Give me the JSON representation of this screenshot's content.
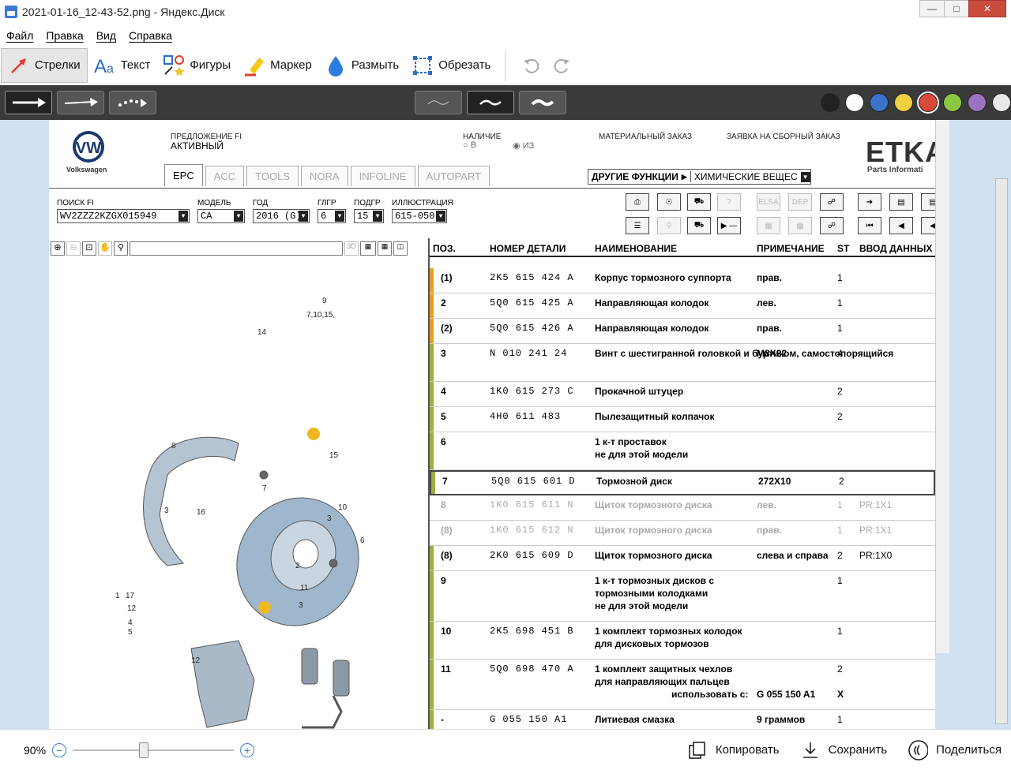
{
  "window": {
    "title": "2021-01-16_12-43-52.png - Яндекс.Диск"
  },
  "menu": [
    "Файл",
    "Правка",
    "Вид",
    "Справка"
  ],
  "toolbar": {
    "tools": [
      {
        "label": "Стрелки",
        "icon": "arrow-icon",
        "active": true
      },
      {
        "label": "Текст",
        "icon": "text-icon"
      },
      {
        "label": "Фигуры",
        "icon": "shapes-icon"
      },
      {
        "label": "Маркер",
        "icon": "marker-icon"
      },
      {
        "label": "Размыть",
        "icon": "blur-icon"
      },
      {
        "label": "Обрезать",
        "icon": "crop-icon"
      }
    ]
  },
  "colors": [
    "#222222",
    "#ffffff",
    "#3a73c9",
    "#f0d040",
    "#d94a3a",
    "#8cc63f",
    "#9b72c4",
    "#e8e8e8"
  ],
  "etka": {
    "offer_label": "ПРЕДЛОЖЕНИЕ FI",
    "offer_value": "АКТИВНЫЙ",
    "availability_label": "НАЛИЧИЕ",
    "avail_in": "В",
    "avail_out": "ИЗ",
    "material_order": "МАТЕРИАЛЬНЫЙ ЗАКАЗ",
    "assembly_order": "ЗАЯВКА НА СБОРНЫЙ ЗАКАЗ",
    "brand": "Volkswagen",
    "logo_text": "ETKA",
    "logo_sub": "Parts Informati",
    "tabs": [
      "EPC",
      "ACC",
      "TOOLS",
      "NORA",
      "INFOLINE",
      "AUTOPART"
    ],
    "other_functions": "ДРУГИЕ ФУНКЦИИ",
    "chemicals": "ХИМИЧЕСКИЕ ВЕЩЕС",
    "fields": {
      "search_label": "ПОИСК FI",
      "search_value": "WV2ZZZ2KZGX015949",
      "model_label": "МОДЕЛЬ",
      "model_value": "CA",
      "year_label": "ГОД",
      "year_value": "2016 (G)",
      "mg_label": "ГЛГР",
      "mg_value": "6",
      "sg_label": "ПОДГР",
      "sg_value": "15",
      "ill_label": "ИЛЛЮСТРАЦИЯ",
      "ill_value": "615-050"
    },
    "columns": [
      "ПОЗ.",
      "НОМЕР ДЕТАЛИ",
      "НАИМЕНОВАНИЕ",
      "ПРИМЕЧАНИЕ",
      "ST",
      "ВВОД ДАННЫХ"
    ],
    "rows": [
      {
        "pos": "(1)",
        "num": "2K5  615  424  A",
        "name": "Корпус тормозного суппорта",
        "note": "прав.",
        "st": "1",
        "data": "",
        "bar": "#e8a020"
      },
      {
        "pos": "2",
        "num": "5Q0  615  425  A",
        "name": "Направляющая колодок",
        "note": "лев.",
        "st": "1",
        "data": "",
        "bar": "#e8a020"
      },
      {
        "pos": "(2)",
        "num": "5Q0  615  426  A",
        "name": "Направляющая колодок",
        "note": "прав.",
        "st": "1",
        "data": "",
        "bar": "#e8a020"
      },
      {
        "pos": "3",
        "num": "N    010  241  24",
        "name": "Винт с шестигранной головкой и буртиком, самостопорящийся",
        "note": "M8X22",
        "st": "4",
        "data": "",
        "bar": "#9bb040"
      },
      {
        "pos": "4",
        "num": "1K0  615  273  C",
        "name": "Прокачной штуцер",
        "note": "",
        "st": "2",
        "data": "",
        "bar": "#9bb040"
      },
      {
        "pos": "5",
        "num": "4H0  611  483",
        "name": "Пылезащитный колпачок",
        "note": "",
        "st": "2",
        "data": "",
        "bar": "#9bb040"
      },
      {
        "pos": "6",
        "num": "",
        "name": "1 к-т проставок\nне для этой модели",
        "note": "",
        "st": "",
        "data": "",
        "bar": "#9bb040"
      },
      {
        "pos": "7",
        "num": "5Q0  615  601  D",
        "name": "Тормозной диск",
        "note": "272X10",
        "st": "2",
        "data": "",
        "bar": "#9bb040",
        "sel": true
      },
      {
        "pos": "8",
        "num": "1K0  615  611  N",
        "name": "Щиток тормозного диска",
        "note": "лев.",
        "st": "1",
        "data": "PR:1X1",
        "bar": "",
        "dim": true
      },
      {
        "pos": "(8)",
        "num": "1K0  615  612  N",
        "name": "Щиток тормозного диска",
        "note": "прав.",
        "st": "1",
        "data": "PR:1X1",
        "bar": "",
        "dim": true
      },
      {
        "pos": "(8)",
        "num": "2K0  615  609  D",
        "name": "Щиток тормозного диска",
        "note": "слева и справа",
        "st": "2",
        "data": "PR:1X0",
        "bar": "#9bb040"
      },
      {
        "pos": "9",
        "num": "",
        "name": "1 к-т тормозных дисков с\nтормозными колодками\nне для этой модели",
        "note": "",
        "st": "1",
        "data": "",
        "bar": "#9bb040"
      },
      {
        "pos": "10",
        "num": "2K5  698  451  B",
        "name": "1 комплект тормозных колодок\nдля дисковых тормозов",
        "note": "",
        "st": "1",
        "data": "",
        "bar": "#9bb040"
      },
      {
        "pos": "11",
        "num": "5Q0  698  470  A",
        "name": "1 комплект защитных чехлов\nдля направляющих пальцев",
        "note": "",
        "st": "2",
        "data": "",
        "bar": "#9bb040",
        "extra_label": "использовать с:",
        "extra_note": "G  055 150 A1",
        "extra_st": "X"
      },
      {
        "pos": "-",
        "num": "G    055  150  A1",
        "name": "Литиевая смазка",
        "note": "9 граммов",
        "st": "1",
        "data": "",
        "bar": "#9bb040"
      }
    ],
    "diagram_labels": [
      "9",
      "7,10,15,",
      "14",
      "8",
      "7",
      "15",
      "3",
      "16",
      "10",
      "3",
      "6",
      "2",
      "1",
      "17",
      "12",
      "4",
      "5",
      "11",
      "3",
      "12"
    ]
  },
  "bottom": {
    "zoom": "90%",
    "copy": "Копировать",
    "save": "Сохранить",
    "share": "Поделиться"
  }
}
